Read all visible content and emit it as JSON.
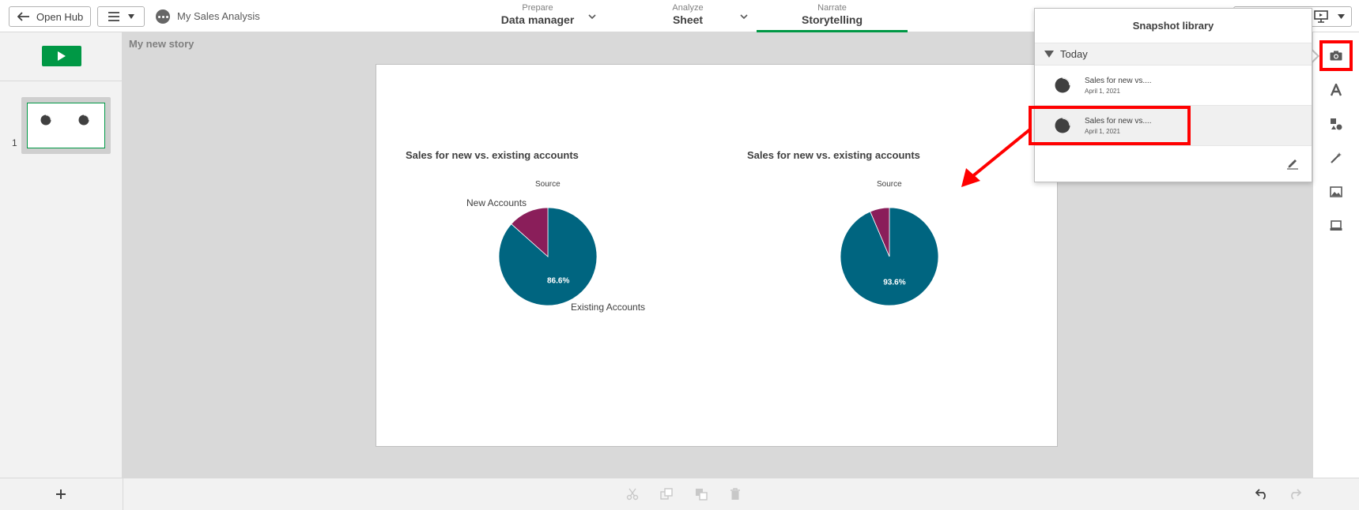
{
  "topbar": {
    "open_hub": "Open Hub",
    "app_name": "My Sales Analysis",
    "tabs": [
      {
        "small": "Prepare",
        "big": "Data manager"
      },
      {
        "small": "Analyze",
        "big": "Sheet"
      },
      {
        "small": "Narrate",
        "big": "Storytelling"
      }
    ],
    "active_tab": "Storytelling"
  },
  "story": {
    "title": "My new story",
    "slide_number": "1"
  },
  "charts": [
    {
      "title": "Sales for new vs. existing accounts",
      "source_label": "Source",
      "label_new": "New Accounts",
      "label_existing": "Existing Accounts",
      "pct_label": "86.6%"
    },
    {
      "title": "Sales for new vs. existing accounts",
      "source_label": "Source",
      "pct_label": "93.6%"
    }
  ],
  "chart_data": [
    {
      "type": "pie",
      "title": "Sales for new vs. existing accounts",
      "subtitle": "Source",
      "categories": [
        "Existing Accounts",
        "New Accounts"
      ],
      "values": [
        86.6,
        13.4
      ],
      "colors": [
        "#006580",
        "#8a1e5a"
      ]
    },
    {
      "type": "pie",
      "title": "Sales for new vs. existing accounts",
      "subtitle": "Source",
      "categories": [
        "Existing Accounts",
        "New Accounts"
      ],
      "values": [
        93.6,
        6.4
      ],
      "colors": [
        "#006580",
        "#8a1e5a"
      ]
    }
  ],
  "snapshot_library": {
    "title": "Snapshot library",
    "group": "Today",
    "items": [
      {
        "title": "Sales for new vs....",
        "date": "April 1, 2021"
      },
      {
        "title": "Sales for new vs....",
        "date": "April 1, 2021"
      }
    ]
  },
  "colors": {
    "accent_green": "#009845",
    "teal": "#006580",
    "magenta": "#8a1e5a",
    "highlight_red": "#ff0000"
  },
  "icons": [
    "back-arrow-icon",
    "hamburger-icon",
    "chevron-down-icon",
    "play-icon",
    "camera-icon",
    "text-icon",
    "shapes-icon",
    "magic-wand-icon",
    "image-icon",
    "media-icon",
    "plus-icon",
    "cut-icon",
    "copy-icon",
    "layer-icon",
    "trash-icon",
    "undo-icon",
    "redo-icon",
    "pie-icon",
    "edit-icon",
    "presentation-icon"
  ]
}
